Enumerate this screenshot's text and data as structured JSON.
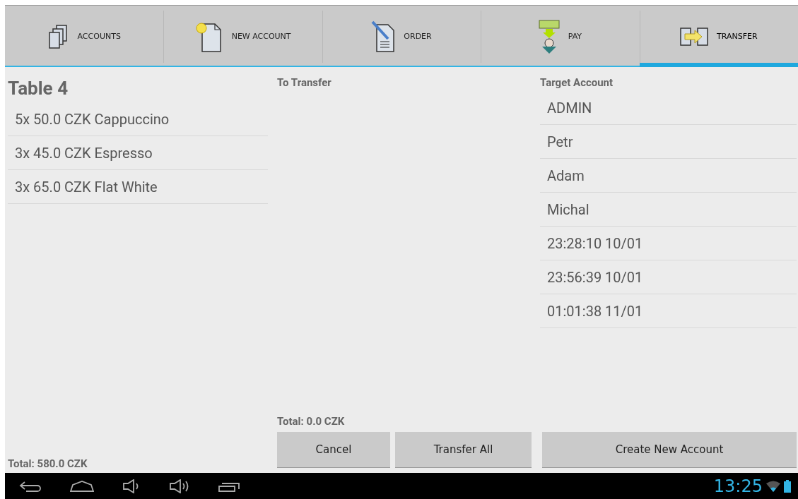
{
  "tabs": [
    {
      "label": "ACCOUNTS",
      "kind": "accounts",
      "selected": false
    },
    {
      "label": "NEW ACCOUNT",
      "kind": "new",
      "selected": false
    },
    {
      "label": "ORDER",
      "kind": "order",
      "selected": false
    },
    {
      "label": "PAY",
      "kind": "pay",
      "selected": false
    },
    {
      "label": "TRANSFER",
      "kind": "transfer",
      "selected": true
    }
  ],
  "table": {
    "title": "Table 4",
    "items": [
      "5x 50.0 CZK Cappuccino",
      "3x 45.0 CZK Espresso",
      "3x 65.0 CZK Flat White"
    ],
    "total": "Total: 580.0 CZK"
  },
  "to_transfer": {
    "heading": "To Transfer",
    "total": "Total: 0.0 CZK",
    "buttons": [
      "Cancel",
      "Transfer All"
    ]
  },
  "target_account": {
    "heading": "Target Account",
    "accounts": [
      "ADMIN",
      "Petr",
      "Adam",
      "Michal",
      "23:28:10 10/01",
      "23:56:39 10/01",
      "01:01:38 11/01"
    ],
    "button": "Create New Account"
  },
  "system_bar": {
    "time": "13:25"
  }
}
